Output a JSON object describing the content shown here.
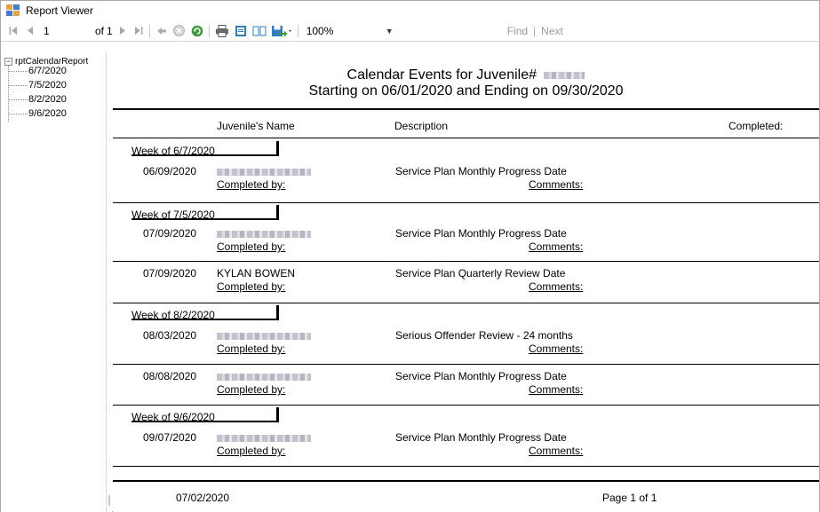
{
  "window": {
    "title": "Report Viewer"
  },
  "toolbar": {
    "page_number": "1",
    "of_label": "of",
    "total_pages": "1",
    "zoom": "100%",
    "find_label": "Find",
    "next_label": "Next"
  },
  "doc_map": {
    "root": "rptCalendarReport",
    "items": [
      {
        "label": "6/7/2020"
      },
      {
        "label": "7/5/2020"
      },
      {
        "label": "8/2/2020"
      },
      {
        "label": "9/6/2020"
      }
    ]
  },
  "report": {
    "title_line1": "Calendar Events for Juvenile#",
    "title_line2": "Starting on 06/01/2020 and Ending on  09/30/2020",
    "headers": {
      "name": "Juvenile's Name",
      "description": "Description",
      "completed": "Completed:"
    },
    "weeks": [
      {
        "label": "Week of 6/7/2020",
        "events": [
          {
            "date": "06/09/2020",
            "name": "",
            "description": "Service Plan Monthly Progress Date",
            "completed_by": "Completed by:",
            "comments": "Comments:"
          }
        ]
      },
      {
        "label": "Week of 7/5/2020",
        "events": [
          {
            "date": "07/09/2020",
            "name": "",
            "description": "Service Plan Monthly Progress Date",
            "completed_by": "Completed by:",
            "comments": "Comments:"
          },
          {
            "date": "07/09/2020",
            "name": "KYLAN BOWEN",
            "description": "Service Plan Quarterly Review Date",
            "completed_by": "Completed by:",
            "comments": "Comments:"
          }
        ]
      },
      {
        "label": "Week of 8/2/2020",
        "events": [
          {
            "date": "08/03/2020",
            "name": "",
            "description": "Serious Offender Review - 24 months",
            "completed_by": "Completed by:",
            "comments": "Comments:"
          },
          {
            "date": "08/08/2020",
            "name": "",
            "description": "Service Plan Monthly Progress Date",
            "completed_by": "Completed by:",
            "comments": "Comments:"
          }
        ]
      },
      {
        "label": "Week of 9/6/2020",
        "events": [
          {
            "date": "09/07/2020",
            "name": "",
            "description": "Service Plan Monthly Progress Date",
            "completed_by": "Completed by:",
            "comments": "Comments:"
          }
        ]
      }
    ],
    "footer_date": "07/02/2020",
    "footer_page": "Page 1 of 1"
  }
}
